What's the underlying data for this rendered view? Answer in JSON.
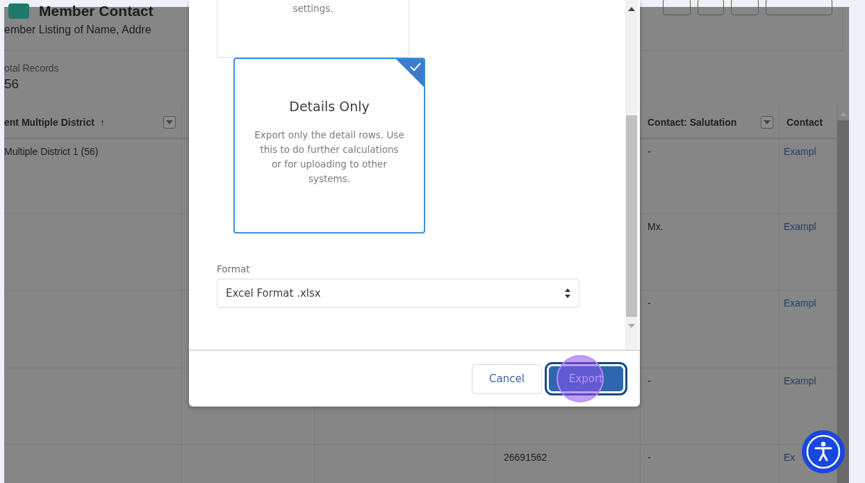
{
  "header": {
    "title": "Member Contact",
    "subtitle": "ember Listing of Name, Addre"
  },
  "summary": {
    "label": "otal Records",
    "value": "56"
  },
  "table": {
    "columns": [
      {
        "label": "ent Multiple District",
        "sort_indicator": "↑",
        "filter": true
      },
      {
        "label": "Contact: Salutation",
        "filter": true
      },
      {
        "label": "Contact",
        "filter": false
      }
    ],
    "rows": [
      {
        "district": "Multiple District 1 (56)",
        "salutation": "-",
        "contact": "Exampl"
      },
      {
        "salutation": "Mx.",
        "contact": "Exampl"
      },
      {
        "salutation": "-",
        "contact": "Exampl"
      },
      {
        "salutation": "-",
        "contact": "Exampl"
      },
      {
        "column_4": "26691562",
        "salutation": "-",
        "contact": "Ex"
      }
    ]
  },
  "dialog": {
    "options": [
      {
        "description": "settings.",
        "selected": false
      },
      {
        "title": "Details Only",
        "description": "Export only the detail rows. Use this to do further calculations or for uploading to other systems.",
        "selected": true
      }
    ],
    "format": {
      "label": "Format",
      "value": "Excel Format .xlsx"
    },
    "buttons": [
      {
        "label": "Cancel",
        "kind": "neutral",
        "focused": false
      },
      {
        "label": "Export",
        "kind": "brand",
        "focused": true
      }
    ]
  }
}
